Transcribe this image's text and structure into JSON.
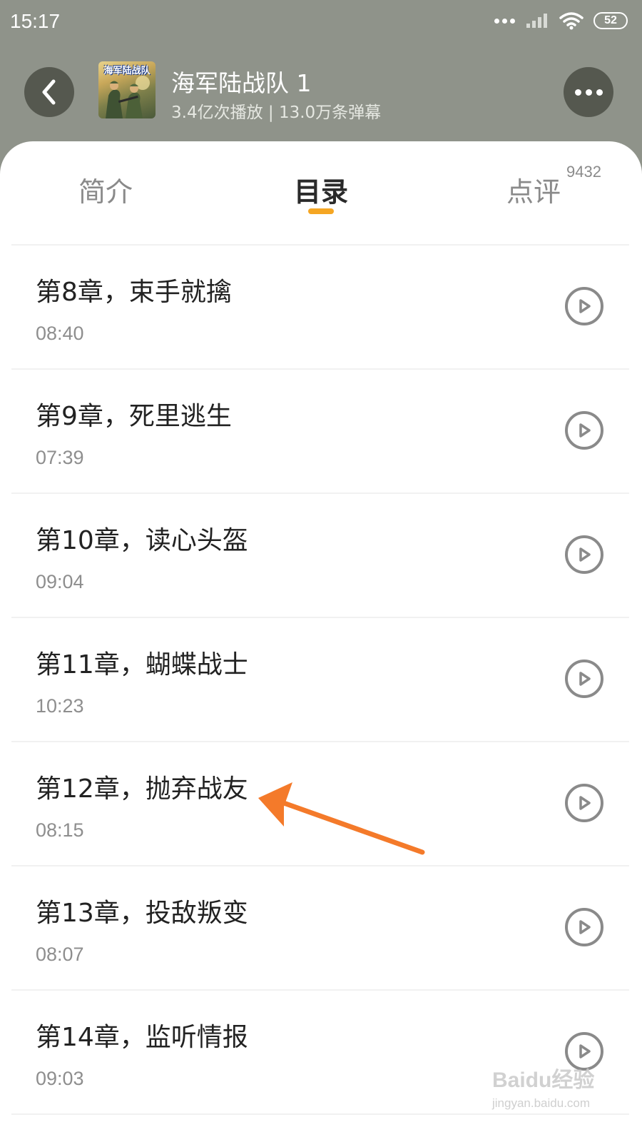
{
  "status_bar": {
    "time": "15:17",
    "battery": "52"
  },
  "header": {
    "cover_text": "海军陆战队",
    "title": "海军陆战队 1",
    "subtitle": "3.4亿次播放 | 13.0万条弹幕"
  },
  "tabs": [
    {
      "label": "简介"
    },
    {
      "label": "目录",
      "active": true
    },
    {
      "label": "点评",
      "badge": "9432"
    }
  ],
  "colors": {
    "accent": "#f5a623",
    "header_bg": "#8f938a",
    "annotation_arrow": "#f47a2a"
  },
  "chapters": [
    {
      "title": "第8章，束手就擒",
      "duration": "08:40"
    },
    {
      "title": "第9章，死里逃生",
      "duration": "07:39"
    },
    {
      "title": "第10章，读心头盔",
      "duration": "09:04"
    },
    {
      "title": "第11章，蝴蝶战士",
      "duration": "10:23"
    },
    {
      "title": "第12章，抛弃战友",
      "duration": "08:15"
    },
    {
      "title": "第13章，投敌叛变",
      "duration": "08:07"
    },
    {
      "title": "第14章，监听情报",
      "duration": "09:03"
    }
  ],
  "watermark": {
    "brand": "Baidu经验",
    "url": "jingyan.baidu.com"
  }
}
